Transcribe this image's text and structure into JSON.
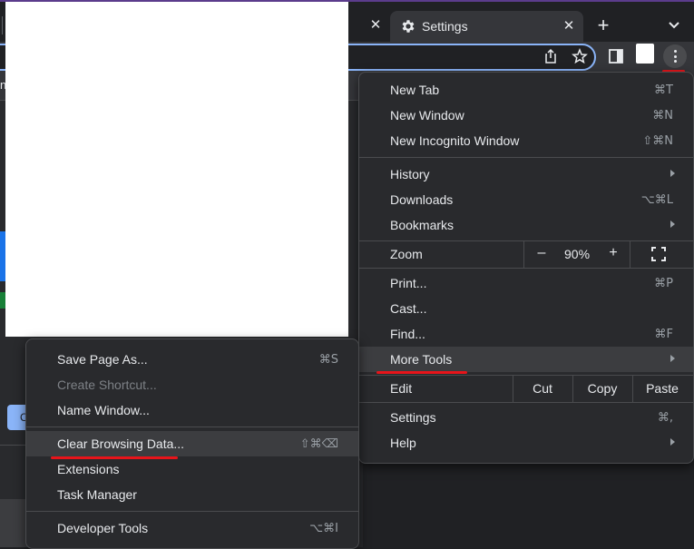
{
  "tabs": {
    "active_title": "Settings",
    "close_glyph": "✕",
    "new_tab_glyph": "+",
    "icons": [
      "gear-icon",
      "close-icon",
      "plus-icon",
      "chevron-down-icon"
    ]
  },
  "toolbar": {
    "icons": [
      "share-icon",
      "star-icon",
      "side-panel-icon",
      "kebab-menu-icon"
    ]
  },
  "bookmarks_bar": {
    "visible_fragment": "n"
  },
  "page": {
    "button_fragment": "C"
  },
  "colors": {
    "accent": "#8ab4f8",
    "menu_bg": "#292a2d",
    "highlight": "#3c3d40",
    "annotation_red": "#e8141a"
  },
  "main_menu": {
    "new_tab": {
      "label": "New Tab",
      "shortcut": "⌘T"
    },
    "new_window": {
      "label": "New Window",
      "shortcut": "⌘N"
    },
    "new_incognito": {
      "label": "New Incognito Window",
      "shortcut": "⇧⌘N"
    },
    "history": {
      "label": "History"
    },
    "downloads": {
      "label": "Downloads",
      "shortcut": "⌥⌘L"
    },
    "bookmarks": {
      "label": "Bookmarks"
    },
    "zoom": {
      "label": "Zoom",
      "minus": "–",
      "value": "90%",
      "plus": "+"
    },
    "print": {
      "label": "Print...",
      "shortcut": "⌘P"
    },
    "cast": {
      "label": "Cast..."
    },
    "find": {
      "label": "Find...",
      "shortcut": "⌘F"
    },
    "more_tools": {
      "label": "More Tools"
    },
    "edit": {
      "label": "Edit",
      "cut": "Cut",
      "copy": "Copy",
      "paste": "Paste"
    },
    "settings": {
      "label": "Settings",
      "shortcut": "⌘,"
    },
    "help": {
      "label": "Help"
    }
  },
  "sub_menu": {
    "save_page": {
      "label": "Save Page As...",
      "shortcut": "⌘S"
    },
    "create_shortcut": {
      "label": "Create Shortcut..."
    },
    "name_window": {
      "label": "Name Window..."
    },
    "clear_browsing": {
      "label": "Clear Browsing Data...",
      "shortcut": "⇧⌘⌫"
    },
    "extensions": {
      "label": "Extensions"
    },
    "task_manager": {
      "label": "Task Manager"
    },
    "developer_tools": {
      "label": "Developer Tools",
      "shortcut": "⌥⌘I"
    }
  }
}
